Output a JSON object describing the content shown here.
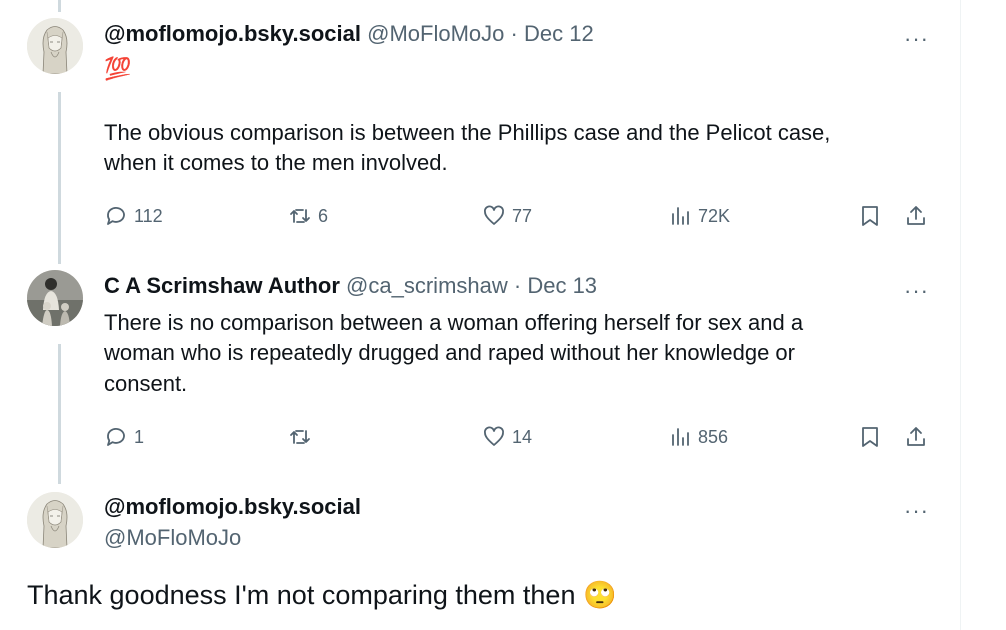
{
  "tweets": [
    {
      "display_name": "@moflomojo.bsky.social",
      "handle": "@MoFloMoJo",
      "separator": "·",
      "date": "Dec 12",
      "emoji": "💯",
      "text_line1": "The obvious comparison is between the Phillips case and the Pelicot case,",
      "text_line2": "when it comes to the men involved.",
      "replies": "112",
      "reposts": "6",
      "likes": "77",
      "views": "72K"
    },
    {
      "display_name": "C A Scrimshaw Author",
      "handle": "@ca_scrimshaw",
      "separator": "·",
      "date": "Dec 13",
      "text_line1": "There is no comparison between a woman offering herself for sex and a",
      "text_line2": "woman who is repeatedly drugged and raped without her knowledge or",
      "text_line3": "consent.",
      "replies": "1",
      "reposts": "",
      "likes": "14",
      "views": "856"
    },
    {
      "display_name": "@moflomojo.bsky.social",
      "handle": "@MoFloMoJo",
      "text": "Thank goodness I'm not comparing them then",
      "emoji": "🙄"
    }
  ],
  "more_label": "···",
  "icons": {
    "reply": "reply-icon",
    "repost": "repost-icon",
    "like": "heart-icon",
    "views": "views-icon",
    "bookmark": "bookmark-icon",
    "share": "share-icon"
  },
  "colors": {
    "text": "#0f1419",
    "secondary": "#536471",
    "thread_line": "#cfd9de"
  }
}
